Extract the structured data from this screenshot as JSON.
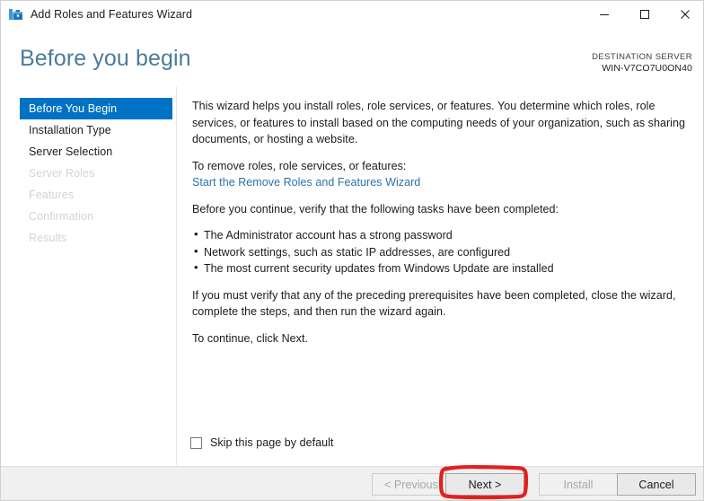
{
  "window": {
    "title": "Add Roles and Features Wizard",
    "icon": "server-manager-icon",
    "controls": {
      "minimize": "minimize-icon",
      "maximize": "maximize-icon",
      "close": "close-icon"
    }
  },
  "header": {
    "page_title": "Before you begin",
    "destination_label": "DESTINATION SERVER",
    "destination_server": "WIN-V7CO7U0ON40"
  },
  "sidebar": {
    "items": [
      {
        "label": "Before You Begin",
        "state": "selected"
      },
      {
        "label": "Installation Type",
        "state": "enabled"
      },
      {
        "label": "Server Selection",
        "state": "enabled"
      },
      {
        "label": "Server Roles",
        "state": "disabled"
      },
      {
        "label": "Features",
        "state": "disabled"
      },
      {
        "label": "Confirmation",
        "state": "disabled"
      },
      {
        "label": "Results",
        "state": "disabled"
      }
    ]
  },
  "content": {
    "intro": "This wizard helps you install roles, role services, or features. You determine which roles, role services, or features to install based on the computing needs of your organization, such as sharing documents, or hosting a website.",
    "remove_heading": "To remove roles, role services, or features:",
    "remove_link": "Start the Remove Roles and Features Wizard",
    "verify_heading": "Before you continue, verify that the following tasks have been completed:",
    "prerequisites": [
      "The Administrator account has a strong password",
      "Network settings, such as static IP addresses, are configured",
      "The most current security updates from Windows Update are installed"
    ],
    "verify_note": "If you must verify that any of the preceding prerequisites have been completed, close the wizard, complete the steps, and then run the wizard again.",
    "continue_note": "To continue, click Next.",
    "skip_checkbox_label": "Skip this page by default",
    "skip_checkbox_checked": false
  },
  "footer": {
    "buttons": [
      {
        "label": "< Previous",
        "state": "disabled"
      },
      {
        "label": "Next >",
        "state": "enabled"
      },
      {
        "label": "Install",
        "state": "disabled"
      },
      {
        "label": "Cancel",
        "state": "enabled"
      }
    ]
  },
  "annotation": {
    "type": "hand-drawn-rectangle",
    "target": "Next >",
    "color": "#e02020"
  }
}
